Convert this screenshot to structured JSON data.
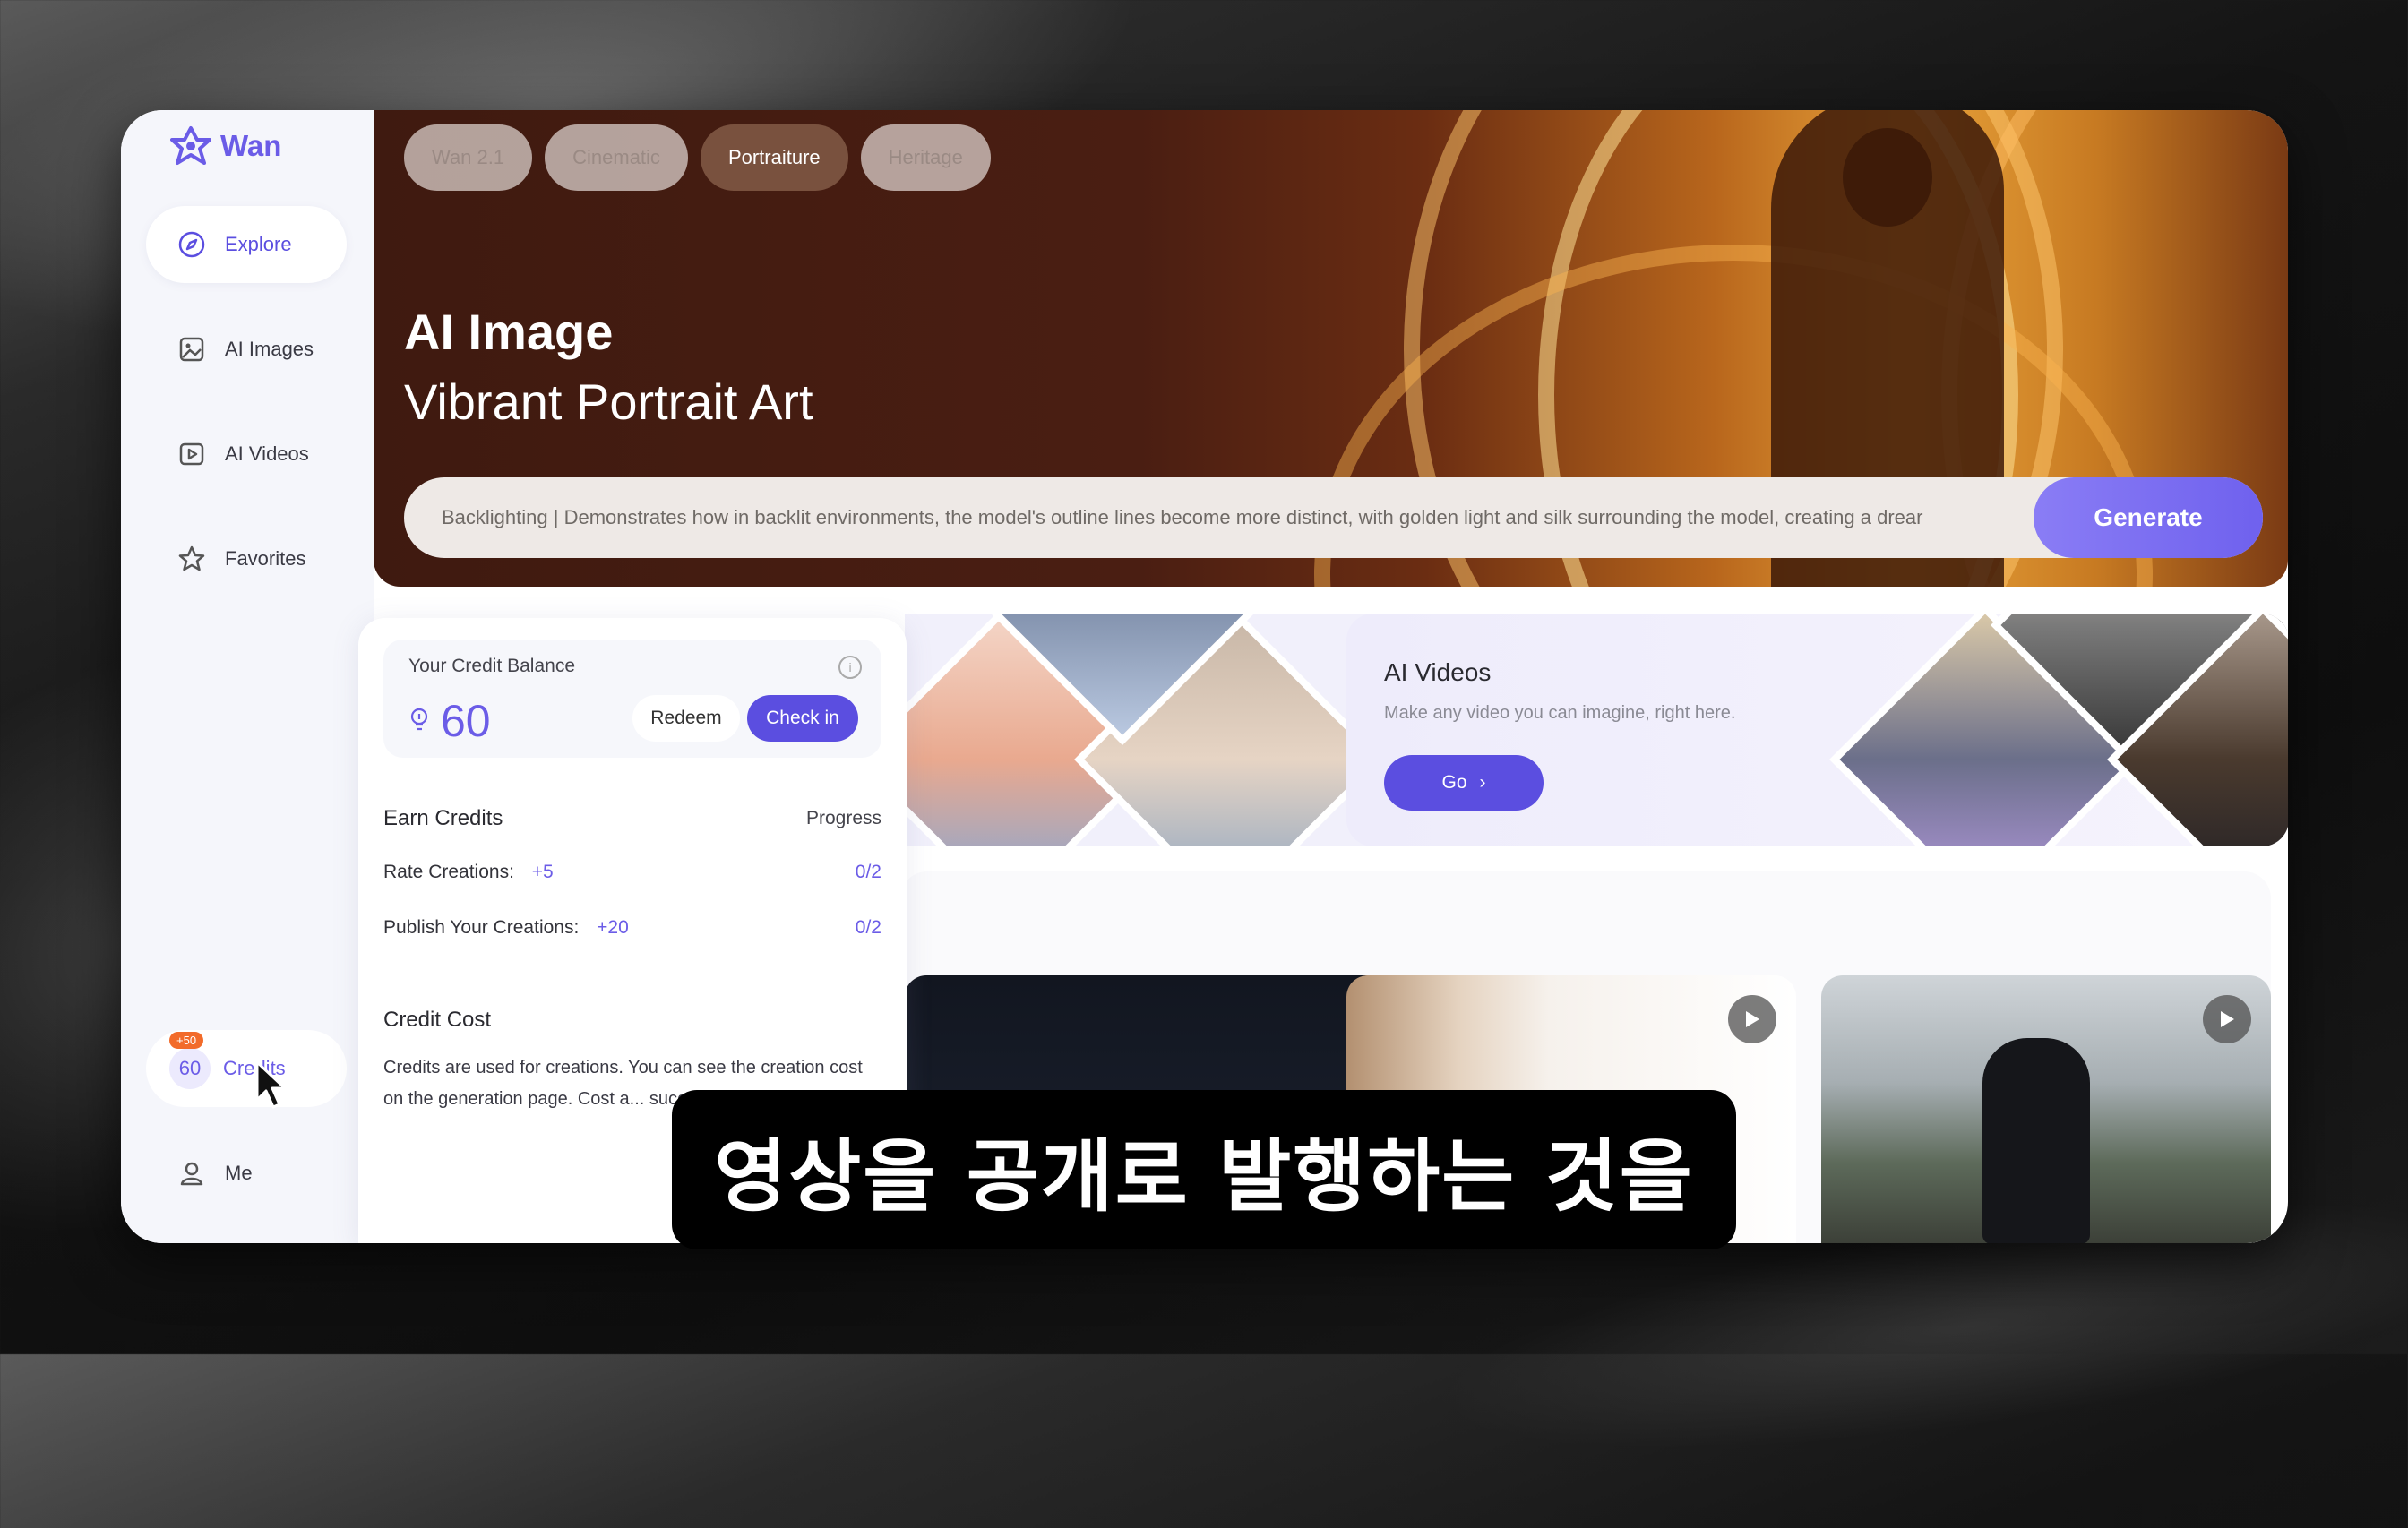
{
  "app": {
    "name": "Wan"
  },
  "sidebar": {
    "items": [
      {
        "label": "Explore",
        "icon": "compass-icon",
        "active": true
      },
      {
        "label": "AI Images",
        "icon": "image-icon",
        "active": false
      },
      {
        "label": "AI Videos",
        "icon": "video-icon",
        "active": false
      },
      {
        "label": "Favorites",
        "icon": "star-icon",
        "active": false
      }
    ],
    "credits": {
      "value": "60",
      "label": "Credits",
      "badge": "+50"
    },
    "me": {
      "label": "Me",
      "icon": "user-icon"
    }
  },
  "hero": {
    "chips": [
      {
        "label": "Wan 2.1",
        "active": false
      },
      {
        "label": "Cinematic",
        "active": false
      },
      {
        "label": "Portraiture",
        "active": true
      },
      {
        "label": "Heritage",
        "active": false
      }
    ],
    "title": "AI Image",
    "subtitle": "Vibrant Portrait Art",
    "prompt": "Backlighting | Demonstrates how in backlit environments, the model's outline lines become more distinct, with golden light and silk surrounding the model, creating a drear",
    "generate_label": "Generate"
  },
  "credit_panel": {
    "balance_title": "Your Credit Balance",
    "balance": "60",
    "redeem_label": "Redeem",
    "checkin_label": "Check in",
    "earn_title": "Earn Credits",
    "progress_title": "Progress",
    "earn_rows": [
      {
        "label": "Rate Creations:",
        "points": "+5",
        "progress": "0/2"
      },
      {
        "label": "Publish Your Creations:",
        "points": "+20",
        "progress": "0/2"
      }
    ],
    "cost_title": "Credit Cost",
    "cost_text": "Credits are used for creations. You can see the creation cost on the generation page. Cost a... successful generations."
  },
  "ai_videos_card": {
    "title": "AI Videos",
    "subtitle": "Make any video you can imagine, right here.",
    "go_label": "Go"
  },
  "subtitle_caption": "영상을 공개로 발행하는 것을",
  "colors": {
    "accent": "#5b4ee0",
    "accent_light": "#6b5ce7",
    "badge": "#f26b2a"
  }
}
